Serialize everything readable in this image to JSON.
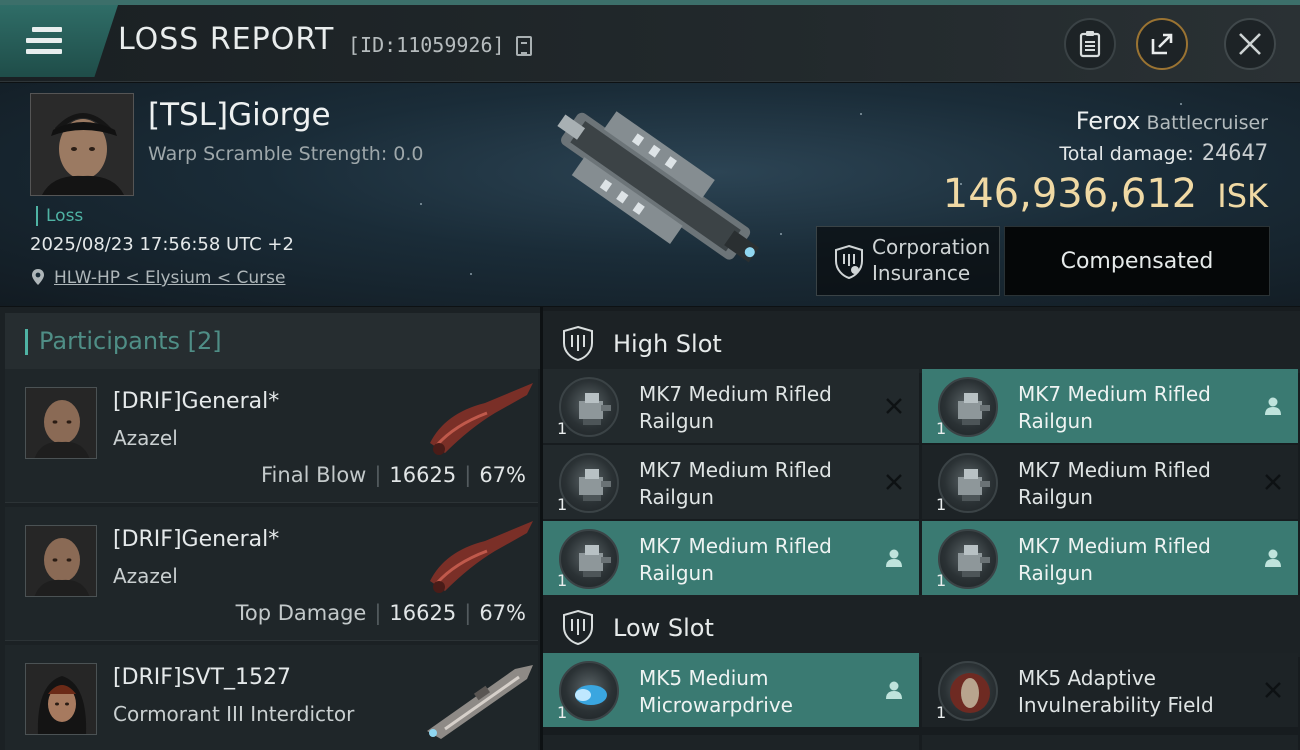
{
  "header": {
    "title": "LOSS REPORT",
    "report_id": "[ID:11059926]"
  },
  "victim": {
    "name": "[TSL]Giorge",
    "warp_scramble": "Warp Scramble Strength: 0.0",
    "type_tag": "Loss",
    "datetime": "2025/08/23 17:56:58 UTC +2",
    "location": "HLW-HP < Elysium < Curse",
    "ship_name": "Ferox",
    "ship_class": "Battlecruiser",
    "total_damage_label": "Total damage:",
    "total_damage": "24647",
    "isk_value": "146,936,612",
    "isk_unit": "ISK",
    "insurance_label_line1": "Corporation",
    "insurance_label_line2": "Insurance",
    "insurance_status": "Compensated"
  },
  "participants": {
    "title": "Participants",
    "count": "[2]",
    "rows": [
      {
        "name": "[DRIF]General*",
        "ship": "Azazel",
        "tag": "Final Blow",
        "damage": "16625",
        "percent": "67%"
      },
      {
        "name": "[DRIF]General*",
        "ship": "Azazel",
        "tag": "Top Damage",
        "damage": "16625",
        "percent": "67%"
      },
      {
        "name": "[DRIF]SVT_1527",
        "ship": "Cormorant III Interdictor"
      }
    ]
  },
  "fitting": {
    "high_slot_label": "High Slot",
    "low_slot_label": "Low Slot",
    "high": [
      {
        "line1": "MK7 Medium Rifled",
        "line2": "Railgun",
        "qty": "1",
        "status": "destroyed"
      },
      {
        "line1": "MK7 Medium Rifled",
        "line2": "Railgun",
        "qty": "1",
        "status": "dropped"
      },
      {
        "line1": "MK7 Medium Rifled",
        "line2": "Railgun",
        "qty": "1",
        "status": "destroyed"
      },
      {
        "line1": "MK7 Medium Rifled",
        "line2": "Railgun",
        "qty": "1",
        "status": "destroyed"
      },
      {
        "line1": "MK7 Medium Rifled",
        "line2": "Railgun",
        "qty": "1",
        "status": "dropped"
      },
      {
        "line1": "MK7 Medium Rifled",
        "line2": "Railgun",
        "qty": "1",
        "status": "dropped"
      }
    ],
    "low": [
      {
        "line1": "MK5 Medium",
        "line2": "Microwarpdrive",
        "qty": "1",
        "status": "dropped"
      },
      {
        "line1": "MK5 Adaptive",
        "line2": "Invulnerability Field",
        "qty": "1",
        "status": "destroyed"
      }
    ]
  },
  "colors": {
    "accent_teal": "#3a7a72",
    "isk_gold": "#f0d9a4",
    "loss_green": "#4fb3a4"
  }
}
